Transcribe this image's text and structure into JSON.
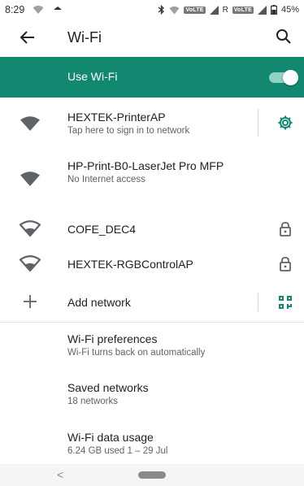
{
  "status_bar": {
    "time": "8:29",
    "volte_1": "VoLTE",
    "roaming": "R",
    "volte_2": "VoLTE",
    "battery": "45%"
  },
  "app_bar": {
    "title": "Wi-Fi"
  },
  "master_switch": {
    "label": "Use Wi-Fi",
    "enabled": true
  },
  "networks": [
    {
      "ssid": "HEXTEK-PrinterAP",
      "status": "Tap here to sign in to network",
      "secured": false,
      "action": "gear-icon"
    },
    {
      "ssid": "HP-Print-B0-LaserJet Pro MFP",
      "status": "No Internet access",
      "secured": false
    },
    {
      "ssid": "COFE_DEC4",
      "status": "",
      "secured": true
    },
    {
      "ssid": "HEXTEK-RGBControlAP",
      "status": "",
      "secured": true
    }
  ],
  "add_network": {
    "label": "Add network"
  },
  "settings_items": [
    {
      "title": "Wi-Fi preferences",
      "subtitle": "Wi-Fi turns back on automatically"
    },
    {
      "title": "Saved networks",
      "subtitle": "18 networks"
    },
    {
      "title": "Wi-Fi data usage",
      "subtitle": "6.24 GB used 1 – 29 Jul"
    }
  ],
  "nav_bar": {
    "back_glyph": "<"
  },
  "colors": {
    "accent": "#138871",
    "icon": "#5f6368"
  }
}
